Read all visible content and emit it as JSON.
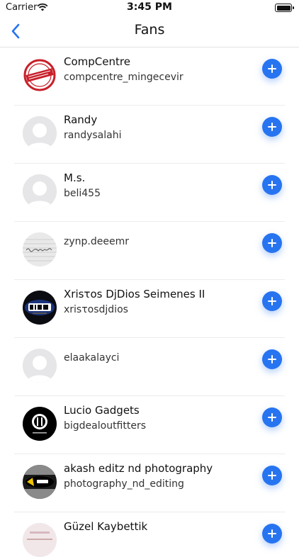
{
  "status": {
    "carrier": "Carrier",
    "time": "3:45 PM"
  },
  "nav": {
    "title": "Fans"
  },
  "fans": [
    {
      "name": "CompCentre",
      "username": "compcentre_mingecevir",
      "avatar": "compcentre-logo"
    },
    {
      "name": "Randy",
      "username": "randysalahi",
      "avatar": "default"
    },
    {
      "name": "M.s.",
      "username": "beli455",
      "avatar": "default"
    },
    {
      "name": "",
      "username": "zynp.deeemr",
      "avatar": "handwriting"
    },
    {
      "name": "Xrisτos DjDios Seimenes II",
      "username": "xrisτosdjdios",
      "avatar": "dios-logo"
    },
    {
      "name": "",
      "username": "elaakalayci",
      "avatar": "default"
    },
    {
      "name": "Lucio Gadgets",
      "username": "bigdealoutfitters",
      "avatar": "lucio-logo"
    },
    {
      "name": "akash editz nd photography",
      "username": "photography_nd_editing",
      "avatar": "akash-logo"
    },
    {
      "name": "Güzel Kaybettik",
      "username": "",
      "avatar": "photo"
    }
  ]
}
